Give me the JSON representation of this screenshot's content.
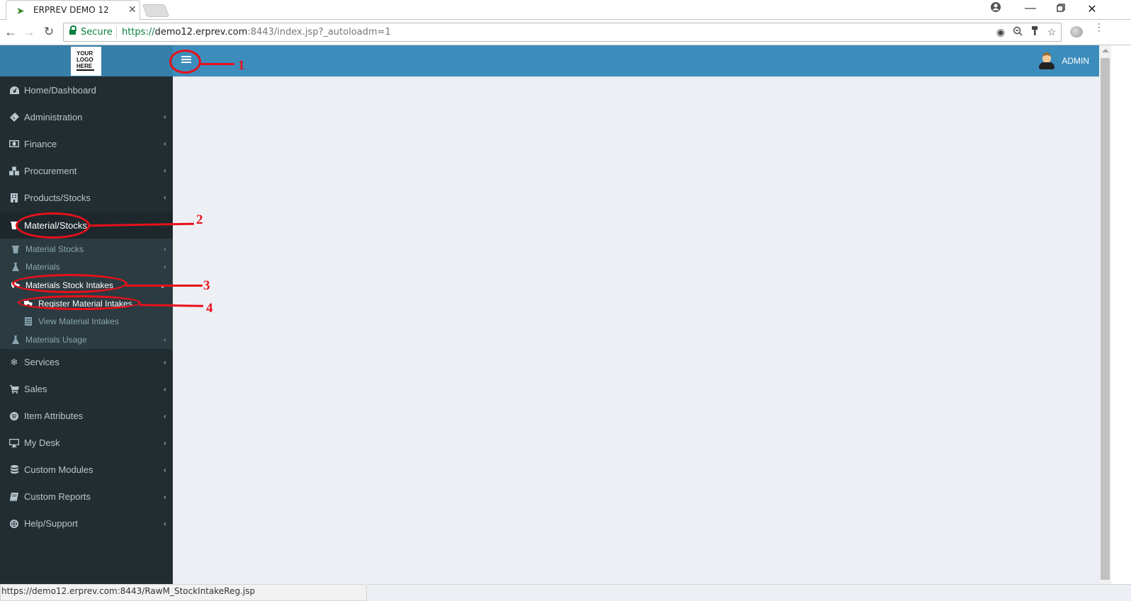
{
  "browser": {
    "tab_title": "ERPREV DEMO 12",
    "tab_favicon": "erprev-bird-icon",
    "secure_label": "Secure",
    "url_scheme": "https://",
    "url_host": "demo12.erprev.com",
    "url_port_path": ":8443/index.jsp?_autoloadm=1",
    "status_url": "https://demo12.erprev.com:8443/RawM_StockIntakeReg.jsp"
  },
  "header": {
    "logo_lines": [
      "YOUR",
      "LOGO",
      "HERE"
    ],
    "user_name": "ADMIN"
  },
  "sidebar": {
    "items": [
      {
        "label": "Home/Dashboard",
        "icon": "dashboard-icon",
        "has_children": false
      },
      {
        "label": "Administration",
        "icon": "ticket-icon",
        "has_children": true
      },
      {
        "label": "Finance",
        "icon": "money-icon",
        "has_children": true
      },
      {
        "label": "Procurement",
        "icon": "cubes-icon",
        "has_children": true
      },
      {
        "label": "Products/Stocks",
        "icon": "building-icon",
        "has_children": true
      },
      {
        "label": "Material/Stocks",
        "icon": "trash-bin-icon",
        "has_children": true,
        "active": true
      },
      {
        "label": "Services",
        "icon": "snowflake-icon",
        "has_children": true
      },
      {
        "label": "Sales",
        "icon": "cart-icon",
        "has_children": true
      },
      {
        "label": "Item Attributes",
        "icon": "spotify-icon",
        "has_children": true
      },
      {
        "label": "My Desk",
        "icon": "desktop-icon",
        "has_children": true
      },
      {
        "label": "Custom Modules",
        "icon": "database-icon",
        "has_children": true
      },
      {
        "label": "Custom Reports",
        "icon": "book-icon",
        "has_children": true
      },
      {
        "label": "Help/Support",
        "icon": "life-ring-icon",
        "has_children": true
      }
    ],
    "material_submenu": [
      {
        "label": "Material Stocks",
        "icon": "trash-bin-icon"
      },
      {
        "label": "Materials",
        "icon": "flask-icon"
      },
      {
        "label": "Materials Stock Intakes",
        "icon": "truck-icon",
        "open": true,
        "children": [
          {
            "label": "Register Material Intakes",
            "icon": "truck-icon",
            "active": true
          },
          {
            "label": "View Material Intakes",
            "icon": "list-icon"
          }
        ]
      },
      {
        "label": "Materials Usage",
        "icon": "flask-icon"
      }
    ]
  },
  "annotations": [
    "1",
    "2",
    "3",
    "4"
  ]
}
